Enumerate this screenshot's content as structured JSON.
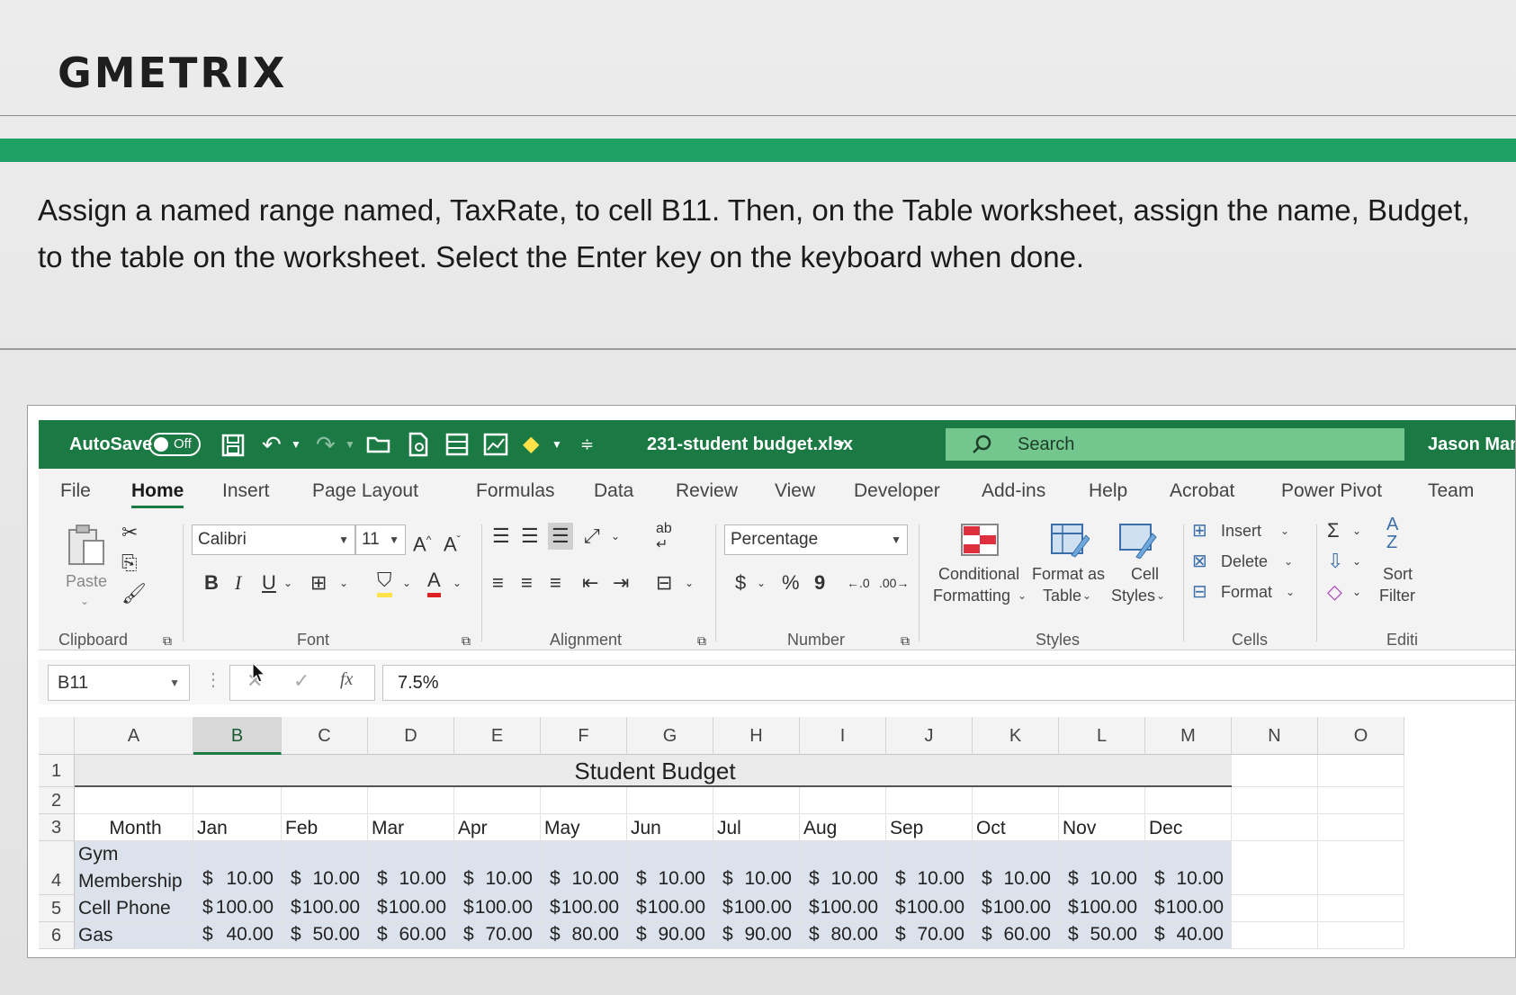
{
  "brand": {
    "logo_text": "GMETRIX"
  },
  "question": {
    "text": "Assign a named range named, TaxRate, to cell B11. Then, on the Table worksheet, assign the name, Budget, to the table on the worksheet. Select the Enter key on the keyboard when done."
  },
  "titlebar": {
    "autosave_label": "AutoSave",
    "autosave_state": "Off",
    "filename": "231-student budget.xlsx",
    "search_placeholder": "Search",
    "user": "Jason Mani"
  },
  "tabs": [
    "File",
    "Home",
    "Insert",
    "Page Layout",
    "Formulas",
    "Data",
    "Review",
    "View",
    "Developer",
    "Add-ins",
    "Help",
    "Acrobat",
    "Power Pivot",
    "Team"
  ],
  "active_tab": "Home",
  "ribbon": {
    "clipboard": {
      "label": "Clipboard",
      "paste": "Paste"
    },
    "font": {
      "label": "Font",
      "name": "Calibri",
      "size": "11",
      "bold": "B",
      "italic": "I",
      "underline": "U"
    },
    "alignment": {
      "label": "Alignment"
    },
    "number": {
      "label": "Number",
      "format": "Percentage",
      "currency": "$",
      "percent": "%",
      "comma": "9"
    },
    "styles": {
      "label": "Styles",
      "conditional_1": "Conditional",
      "conditional_2": "Formatting",
      "format_table_1": "Format as",
      "format_table_2": "Table",
      "cell_styles_1": "Cell",
      "cell_styles_2": "Styles"
    },
    "cells": {
      "label": "Cells",
      "insert": "Insert",
      "delete": "Delete",
      "format": "Format"
    },
    "editing": {
      "label": "Editi",
      "sort_1": "Sort",
      "sort_2": "Filter"
    }
  },
  "formula_bar": {
    "name_box": "B11",
    "formula": "7.5%"
  },
  "sheet": {
    "columns": [
      "A",
      "B",
      "C",
      "D",
      "E",
      "F",
      "G",
      "H",
      "I",
      "J",
      "K",
      "L",
      "M",
      "N",
      "O"
    ],
    "rows": [
      "1",
      "2",
      "3",
      "4",
      "5",
      "6"
    ],
    "title": "Student Budget",
    "header": [
      "Month",
      "Jan",
      "Feb",
      "Mar",
      "Apr",
      "May",
      "Jun",
      "Jul",
      "Aug",
      "Sep",
      "Oct",
      "Nov",
      "Dec"
    ],
    "data": [
      {
        "label_line1": "Gym",
        "label_line2": "Membership",
        "values": [
          "10.00",
          "10.00",
          "10.00",
          "10.00",
          "10.00",
          "10.00",
          "10.00",
          "10.00",
          "10.00",
          "10.00",
          "10.00",
          "10.00"
        ]
      },
      {
        "label": "Cell Phone",
        "values": [
          "100.00",
          "100.00",
          "100.00",
          "100.00",
          "100.00",
          "100.00",
          "100.00",
          "100.00",
          "100.00",
          "100.00",
          "100.00",
          "100.00"
        ]
      },
      {
        "label": "Gas",
        "values": [
          "40.00",
          "50.00",
          "60.00",
          "70.00",
          "80.00",
          "90.00",
          "90.00",
          "80.00",
          "70.00",
          "60.00",
          "50.00",
          "40.00"
        ]
      }
    ],
    "currency_symbol": "$"
  },
  "colors": {
    "excel_green": "#1b7a43",
    "gmetrix_green": "#1ea064",
    "table_band": "#dbe2ec"
  }
}
